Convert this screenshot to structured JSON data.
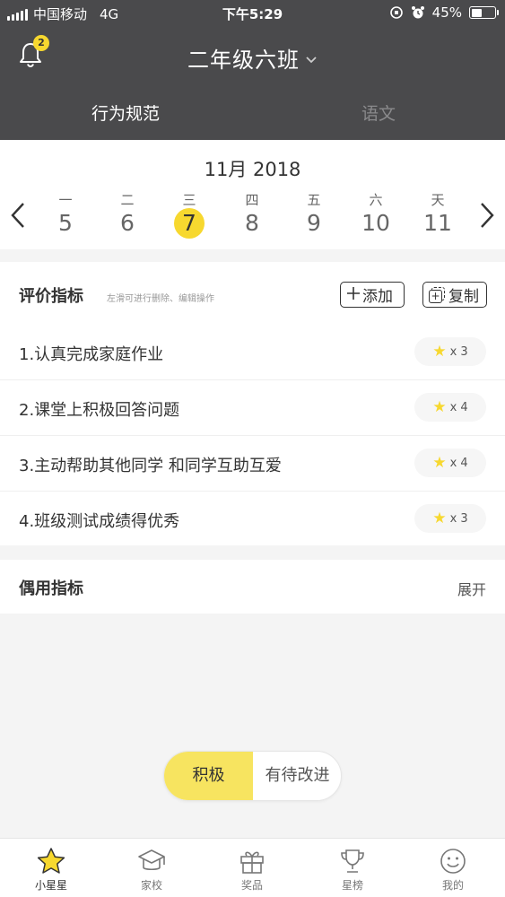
{
  "status_bar": {
    "carrier": "中国移动",
    "network": "4G",
    "time": "下午5:29",
    "battery": "45%",
    "battery_level": 0.45
  },
  "header": {
    "notification_count": "2",
    "class_name": "二年级六班",
    "tabs": [
      {
        "label": "行为规范",
        "active": true
      },
      {
        "label": "语文",
        "active": false
      }
    ]
  },
  "calendar": {
    "month_label": "11月 2018",
    "days": [
      {
        "weekday": "一",
        "date": "5",
        "selected": false
      },
      {
        "weekday": "二",
        "date": "6",
        "selected": false
      },
      {
        "weekday": "三",
        "date": "7",
        "selected": true
      },
      {
        "weekday": "四",
        "date": "8",
        "selected": false
      },
      {
        "weekday": "五",
        "date": "9",
        "selected": false
      },
      {
        "weekday": "六",
        "date": "10",
        "selected": false
      },
      {
        "weekday": "天",
        "date": "11",
        "selected": false
      }
    ]
  },
  "indicators": {
    "title": "评价指标",
    "hint": "左滑可进行删除、编辑操作",
    "add_label": "添加",
    "copy_label": "复制",
    "items": [
      {
        "label": "1.认真完成家庭作业",
        "multiplier": "x 3"
      },
      {
        "label": "2.课堂上积极回答问题",
        "multiplier": "x 4"
      },
      {
        "label": "3.主动帮助其他同学 和同学互助互爱",
        "multiplier": "x 4"
      },
      {
        "label": "4.班级测试成绩得优秀",
        "multiplier": "x 3"
      }
    ]
  },
  "common": {
    "title": "偶用指标",
    "expand_label": "展开"
  },
  "mode_toggle": {
    "positive_label": "积极",
    "improve_label": "有待改进"
  },
  "nav": {
    "items": [
      {
        "label": "小星星",
        "icon": "star-icon",
        "active": true
      },
      {
        "label": "家校",
        "icon": "school-cap-icon",
        "active": false
      },
      {
        "label": "奖品",
        "icon": "gift-icon",
        "active": false
      },
      {
        "label": "星榜",
        "icon": "trophy-icon",
        "active": false
      },
      {
        "label": "我的",
        "icon": "smile-icon",
        "active": false
      }
    ]
  },
  "colors": {
    "accent": "#f7d82f",
    "header_bg": "#4a4a4c"
  }
}
